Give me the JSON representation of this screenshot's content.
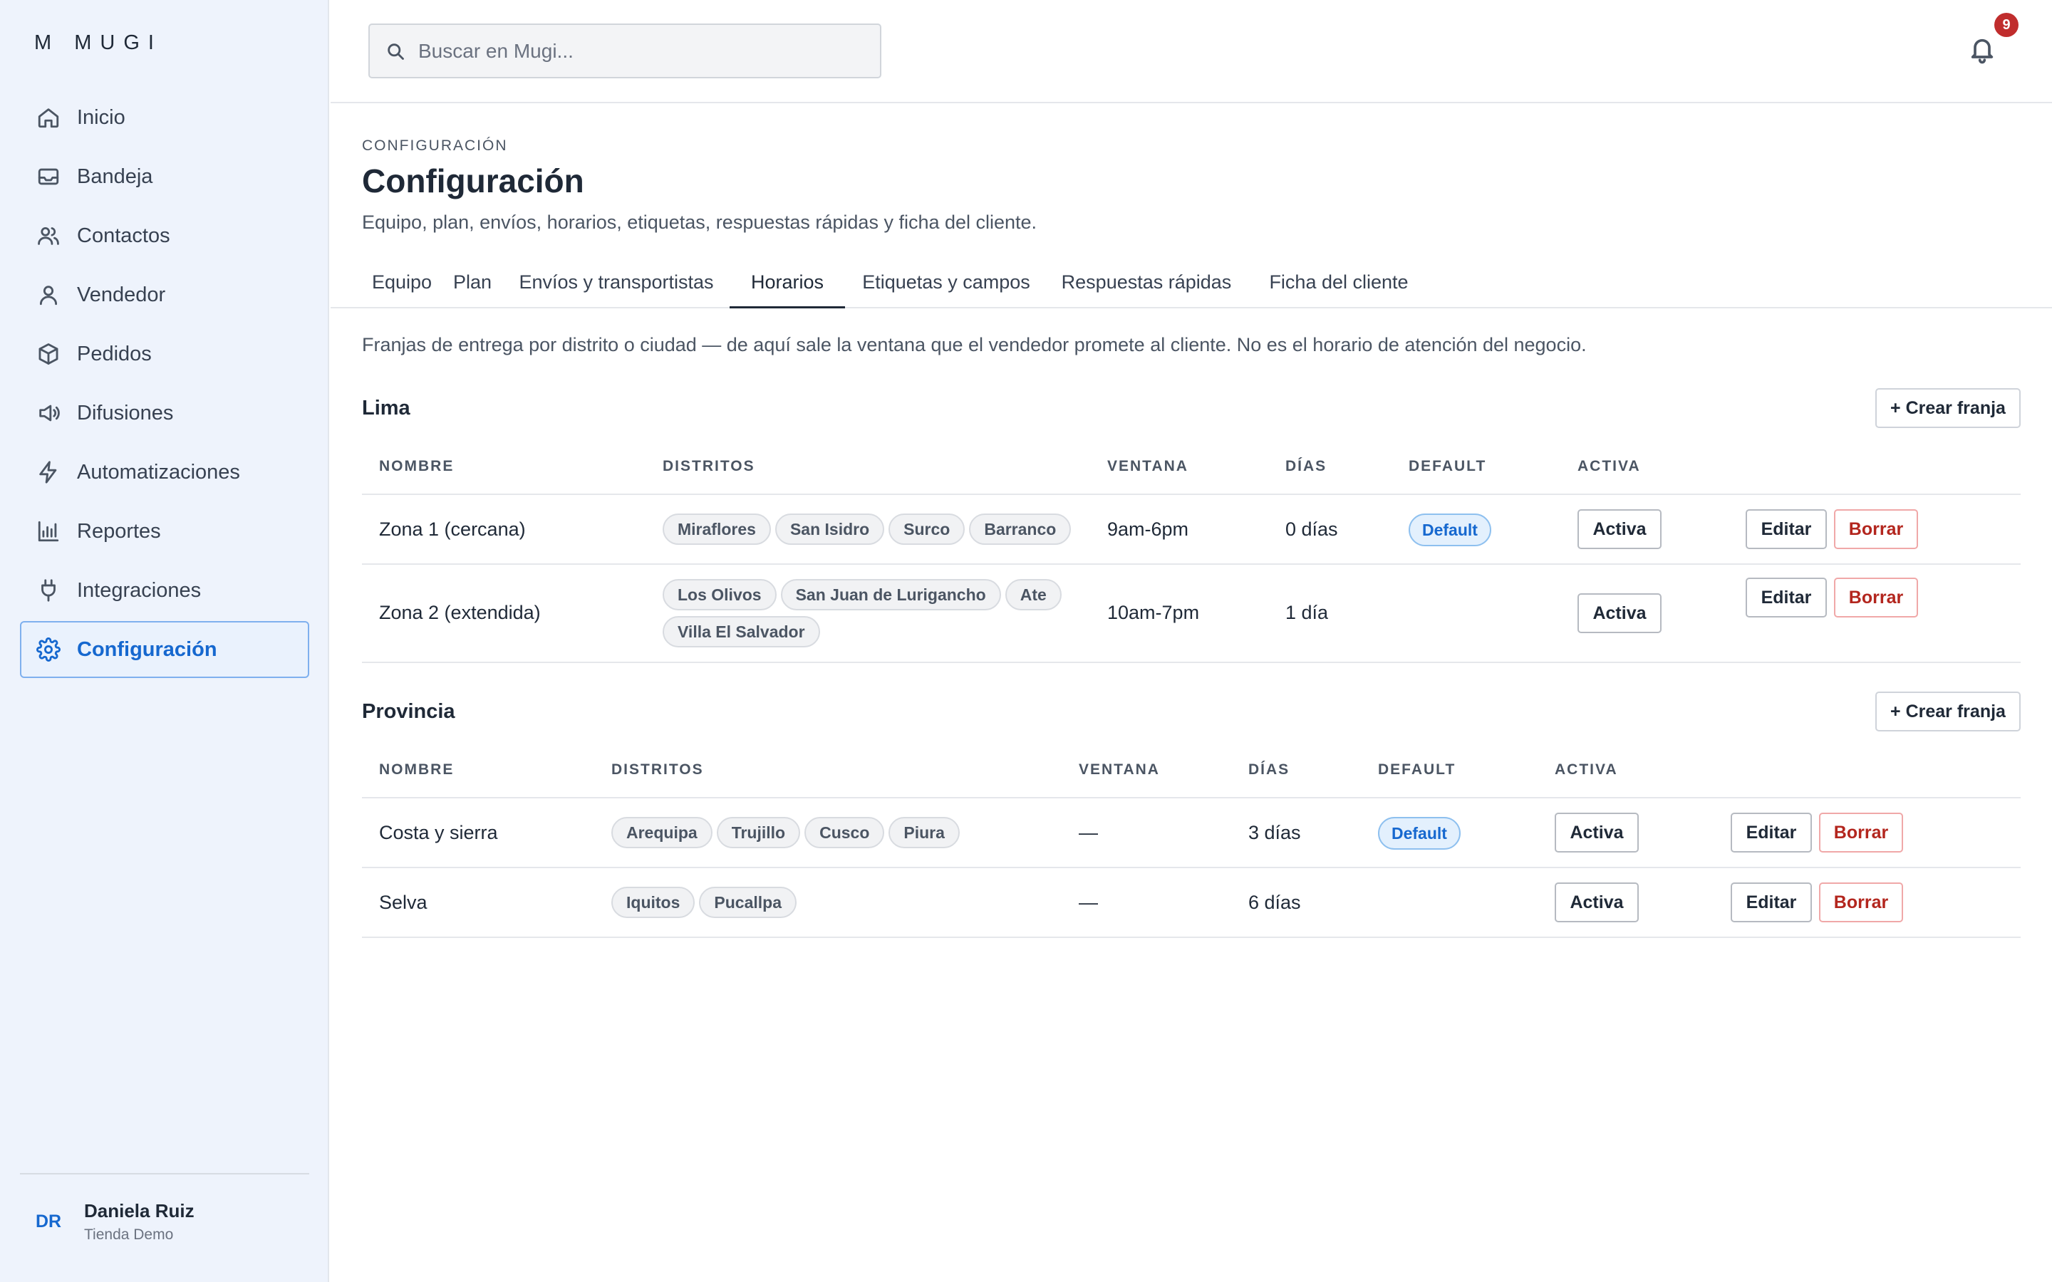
{
  "app": {
    "logo": "M MUGI"
  },
  "sidebar": {
    "items": [
      {
        "label": "Inicio",
        "icon": "home-icon"
      },
      {
        "label": "Bandeja",
        "icon": "inbox-icon"
      },
      {
        "label": "Contactos",
        "icon": "users-icon"
      },
      {
        "label": "Vendedor",
        "icon": "user-icon"
      },
      {
        "label": "Pedidos",
        "icon": "box-icon"
      },
      {
        "label": "Difusiones",
        "icon": "megaphone-icon"
      },
      {
        "label": "Automatizaciones",
        "icon": "bolt-icon"
      },
      {
        "label": "Reportes",
        "icon": "bar-chart-icon"
      },
      {
        "label": "Integraciones",
        "icon": "plug-icon"
      },
      {
        "label": "Configuración",
        "icon": "gear-icon"
      }
    ],
    "active_item": "Configuración",
    "user": {
      "initials": "DR",
      "name": "Daniela Ruiz",
      "store": "Tienda Demo"
    }
  },
  "topbar": {
    "search_placeholder": "Buscar en Mugi...",
    "notifications_count": "9"
  },
  "page": {
    "eyebrow": "CONFIGURACIÓN",
    "title": "Configuración",
    "subtitle": "Equipo, plan, envíos, horarios, etiquetas, respuestas rápidas y ficha del cliente.",
    "tabs": [
      "Equipo",
      "Plan",
      "Envíos y transportistas",
      "Horarios",
      "Etiquetas y campos",
      "Respuestas rápidas",
      "Ficha del cliente"
    ],
    "active_tab": "Horarios",
    "description": "Franjas de entrega por distrito o ciudad — de aquí sale la ventana que el vendedor promete al cliente. No es el horario de atención del negocio."
  },
  "columns": {
    "name": "NOMBRE",
    "districts": "DISTRITOS",
    "window": "VENTANA",
    "days": "DÍAS",
    "default": "DEFAULT",
    "active": "ACTIVA"
  },
  "actions": {
    "create": "+ Crear franja",
    "active": "Activa",
    "edit": "Editar",
    "delete": "Borrar",
    "default_badge": "Default"
  },
  "sections": [
    {
      "title": "Lima",
      "rows": [
        {
          "name": "Zona 1 (cercana)",
          "districts": [
            "Miraflores",
            "San Isidro",
            "Surco",
            "Barranco"
          ],
          "window": "9am-6pm",
          "days": "0 días",
          "is_default": true
        },
        {
          "name": "Zona 2 (extendida)",
          "districts": [
            "Los Olivos",
            "San Juan de Lurigancho",
            "Ate",
            "Villa El Salvador"
          ],
          "window": "10am-7pm",
          "days": "1 día",
          "is_default": false
        }
      ]
    },
    {
      "title": "Provincia",
      "rows": [
        {
          "name": "Costa y sierra",
          "districts": [
            "Arequipa",
            "Trujillo",
            "Cusco",
            "Piura"
          ],
          "window": "—",
          "days": "3 días",
          "is_default": true
        },
        {
          "name": "Selva",
          "districts": [
            "Iquitos",
            "Pucallpa"
          ],
          "window": "—",
          "days": "6 días",
          "is_default": false
        }
      ]
    }
  ]
}
